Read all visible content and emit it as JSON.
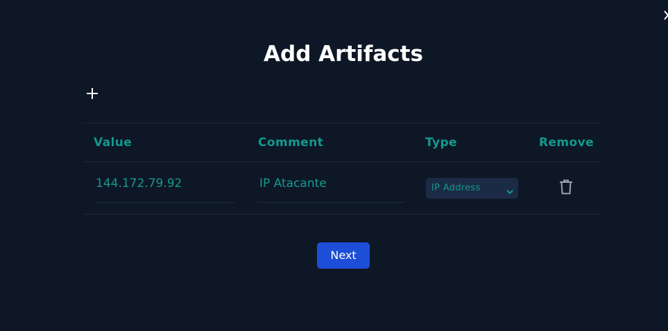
{
  "modal": {
    "title": "Add Artifacts",
    "close_icon": "close-icon",
    "add_icon": "plus-icon"
  },
  "table": {
    "headers": {
      "value": "Value",
      "comment": "Comment",
      "type": "Type",
      "remove": "Remove"
    },
    "rows": [
      {
        "value": "144.172.79.92",
        "comment": "IP Atacante",
        "type": "IP Address",
        "remove_icon": "trash-icon"
      }
    ]
  },
  "footer": {
    "next_label": "Next"
  },
  "colors": {
    "background": "#0e1726",
    "accent": "#129a8d",
    "primary_button": "#1d4ed8",
    "select_bg": "#1b2a45"
  }
}
